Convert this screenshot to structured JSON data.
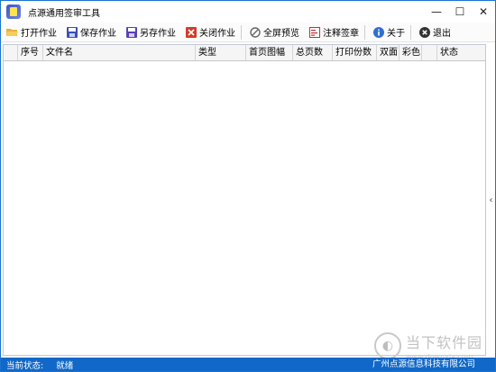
{
  "window": {
    "title": "点源通用签审工具"
  },
  "window_controls": {
    "minimize": "—",
    "maximize": "☐",
    "close": "✕"
  },
  "toolbar": {
    "buttons": [
      {
        "label": "打开作业",
        "icon": "folder-open-icon",
        "color": "#d9a520"
      },
      {
        "label": "保存作业",
        "icon": "save-icon",
        "color": "#3a4fb8"
      },
      {
        "label": "另存作业",
        "icon": "save-as-icon",
        "color": "#5a3fb8"
      },
      {
        "label": "关闭作业",
        "icon": "close-job-icon",
        "color": "#d43a2a"
      },
      {
        "label": "全屏预览",
        "icon": "preview-icon",
        "color": "#666666"
      },
      {
        "label": "注释签章",
        "icon": "annotate-icon",
        "color": "#c03030"
      },
      {
        "label": "关于",
        "icon": "info-icon",
        "color": "#2f6fd1"
      },
      {
        "label": "退出",
        "icon": "exit-icon",
        "color": "#333333"
      }
    ]
  },
  "grid": {
    "columns": [
      "",
      "序号",
      "文件名",
      "类型",
      "首页图幅",
      "总页数",
      "打印份数",
      "双面",
      "彩色",
      "",
      "状态"
    ],
    "rows": []
  },
  "collapse_handle": "‹",
  "statusbar": {
    "label": "当前状态:",
    "value": "就绪",
    "company": "广州点源信息科技有限公司"
  },
  "watermark": {
    "main": "当下软件园",
    "sub": "www.downxia.com"
  },
  "colors": {
    "accent": "#1168c8",
    "border": "#1a73d1"
  }
}
